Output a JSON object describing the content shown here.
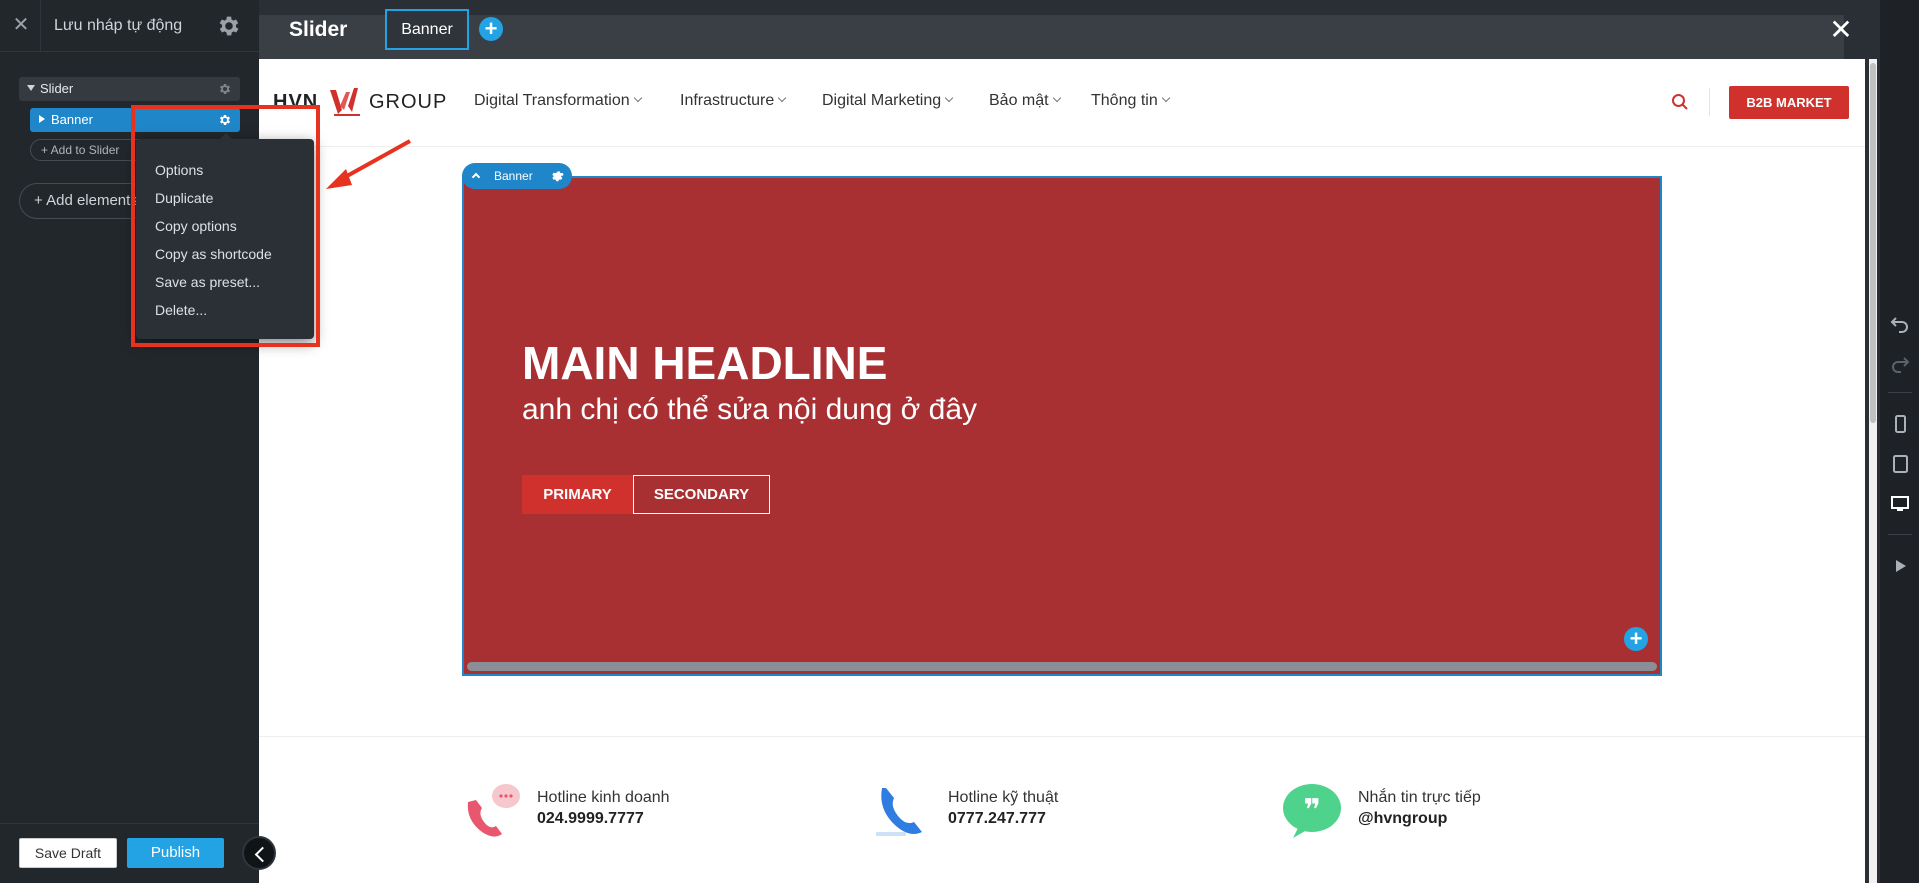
{
  "sidebar": {
    "title": "Lưu nháp tự động",
    "tree": {
      "slider_label": "Slider",
      "banner_label": "Banner",
      "add_to_slider": "+ Add to Slider",
      "add_elements": "+ Add elements"
    },
    "context_menu": [
      "Options",
      "Duplicate",
      "Copy options",
      "Copy as shortcode",
      "Save as preset...",
      "Delete..."
    ],
    "save_draft": "Save Draft",
    "publish": "Publish"
  },
  "topbar": {
    "title": "Slider",
    "active_tab": "Banner"
  },
  "site": {
    "logo_left": "HVN",
    "logo_right": "GROUP",
    "nav": [
      "Digital Transformation",
      "Infrastructure",
      "Digital Marketing",
      "Bảo mật",
      "Thông tin"
    ],
    "cta": "B2B MARKET"
  },
  "banner": {
    "tag": "Banner",
    "headline": "MAIN HEADLINE",
    "subline": "anh chị có thể sửa nội dung ở đây",
    "primary": "PRIMARY",
    "secondary": "SECONDARY"
  },
  "contacts": [
    {
      "label": "Hotline kinh doanh",
      "value": "024.9999.7777"
    },
    {
      "label": "Hotline kỹ thuật",
      "value": "0777.247.777"
    },
    {
      "label": "Nhắn tin trực tiếp",
      "value": "@hvngroup"
    }
  ],
  "colors": {
    "brand_red": "#d0312d",
    "banner_bg": "#a93032",
    "accent_blue": "#23a3e3",
    "sidebar_bg": "#22272c"
  }
}
